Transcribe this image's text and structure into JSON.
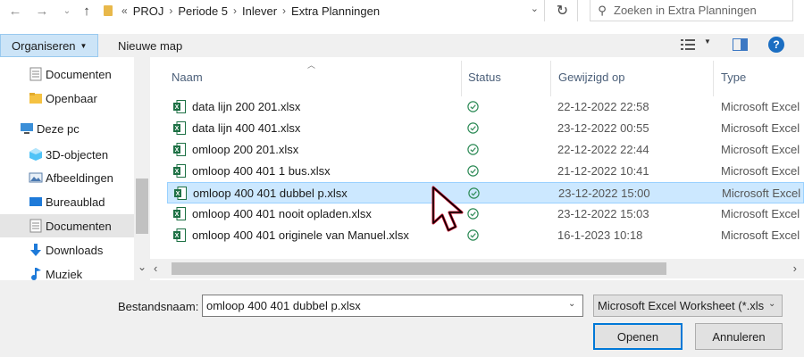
{
  "address_bar": {
    "overflow": "«",
    "breadcrumbs": [
      "PROJ",
      "Periode 5",
      "Inlever",
      "Extra Planningen"
    ],
    "search_placeholder": "Zoeken in Extra Planningen"
  },
  "command_bar": {
    "organize_label": "Organiseren",
    "new_folder_label": "Nieuwe map"
  },
  "nav_pane": {
    "items": [
      {
        "label": "Documenten",
        "icon": "documents-icon"
      },
      {
        "label": "Openbaar",
        "icon": "folder-icon"
      },
      {
        "label": "Deze pc",
        "icon": "this-pc-icon"
      },
      {
        "label": "3D-objecten",
        "icon": "3d-objects-icon"
      },
      {
        "label": "Afbeeldingen",
        "icon": "pictures-icon"
      },
      {
        "label": "Bureaublad",
        "icon": "desktop-icon"
      },
      {
        "label": "Documenten",
        "icon": "documents-icon",
        "selected": true
      },
      {
        "label": "Downloads",
        "icon": "downloads-icon"
      },
      {
        "label": "Muziek",
        "icon": "music-icon"
      }
    ]
  },
  "file_list": {
    "columns": {
      "name": "Naam",
      "status": "Status",
      "modified": "Gewijzigd op",
      "type": "Type"
    },
    "rows": [
      {
        "name": "data lijn 200 201.xlsx",
        "modified": "22-12-2022 22:58",
        "type": "Microsoft Excel"
      },
      {
        "name": "data lijn 400 401.xlsx",
        "modified": "23-12-2022 00:55",
        "type": "Microsoft Excel"
      },
      {
        "name": "omloop 200 201.xlsx",
        "modified": "22-12-2022 22:44",
        "type": "Microsoft Excel"
      },
      {
        "name": "omloop 400 401 1 bus.xlsx",
        "modified": "21-12-2022 10:41",
        "type": "Microsoft Excel"
      },
      {
        "name": "omloop 400 401 dubbel p.xlsx",
        "modified": "23-12-2022 15:00",
        "type": "Microsoft Excel",
        "selected": true
      },
      {
        "name": "omloop 400 401 nooit opladen.xlsx",
        "modified": "23-12-2022 15:03",
        "type": "Microsoft Excel"
      },
      {
        "name": "omloop 400 401 originele van Manuel.xlsx",
        "modified": "16-1-2023 10:18",
        "type": "Microsoft Excel"
      }
    ]
  },
  "bottom": {
    "filename_label": "Bestandsnaam:",
    "filename_value": "omloop 400 401 dubbel p.xlsx",
    "filetype_value": "Microsoft Excel Worksheet (*.xls",
    "open_label": "Openen",
    "cancel_label": "Annuleren"
  },
  "colors": {
    "selection_bg": "#cce8ff",
    "selection_border": "#99d1ff",
    "accent": "#0078d7",
    "excel_green": "#1d7044",
    "status_green": "#2e8b57"
  }
}
